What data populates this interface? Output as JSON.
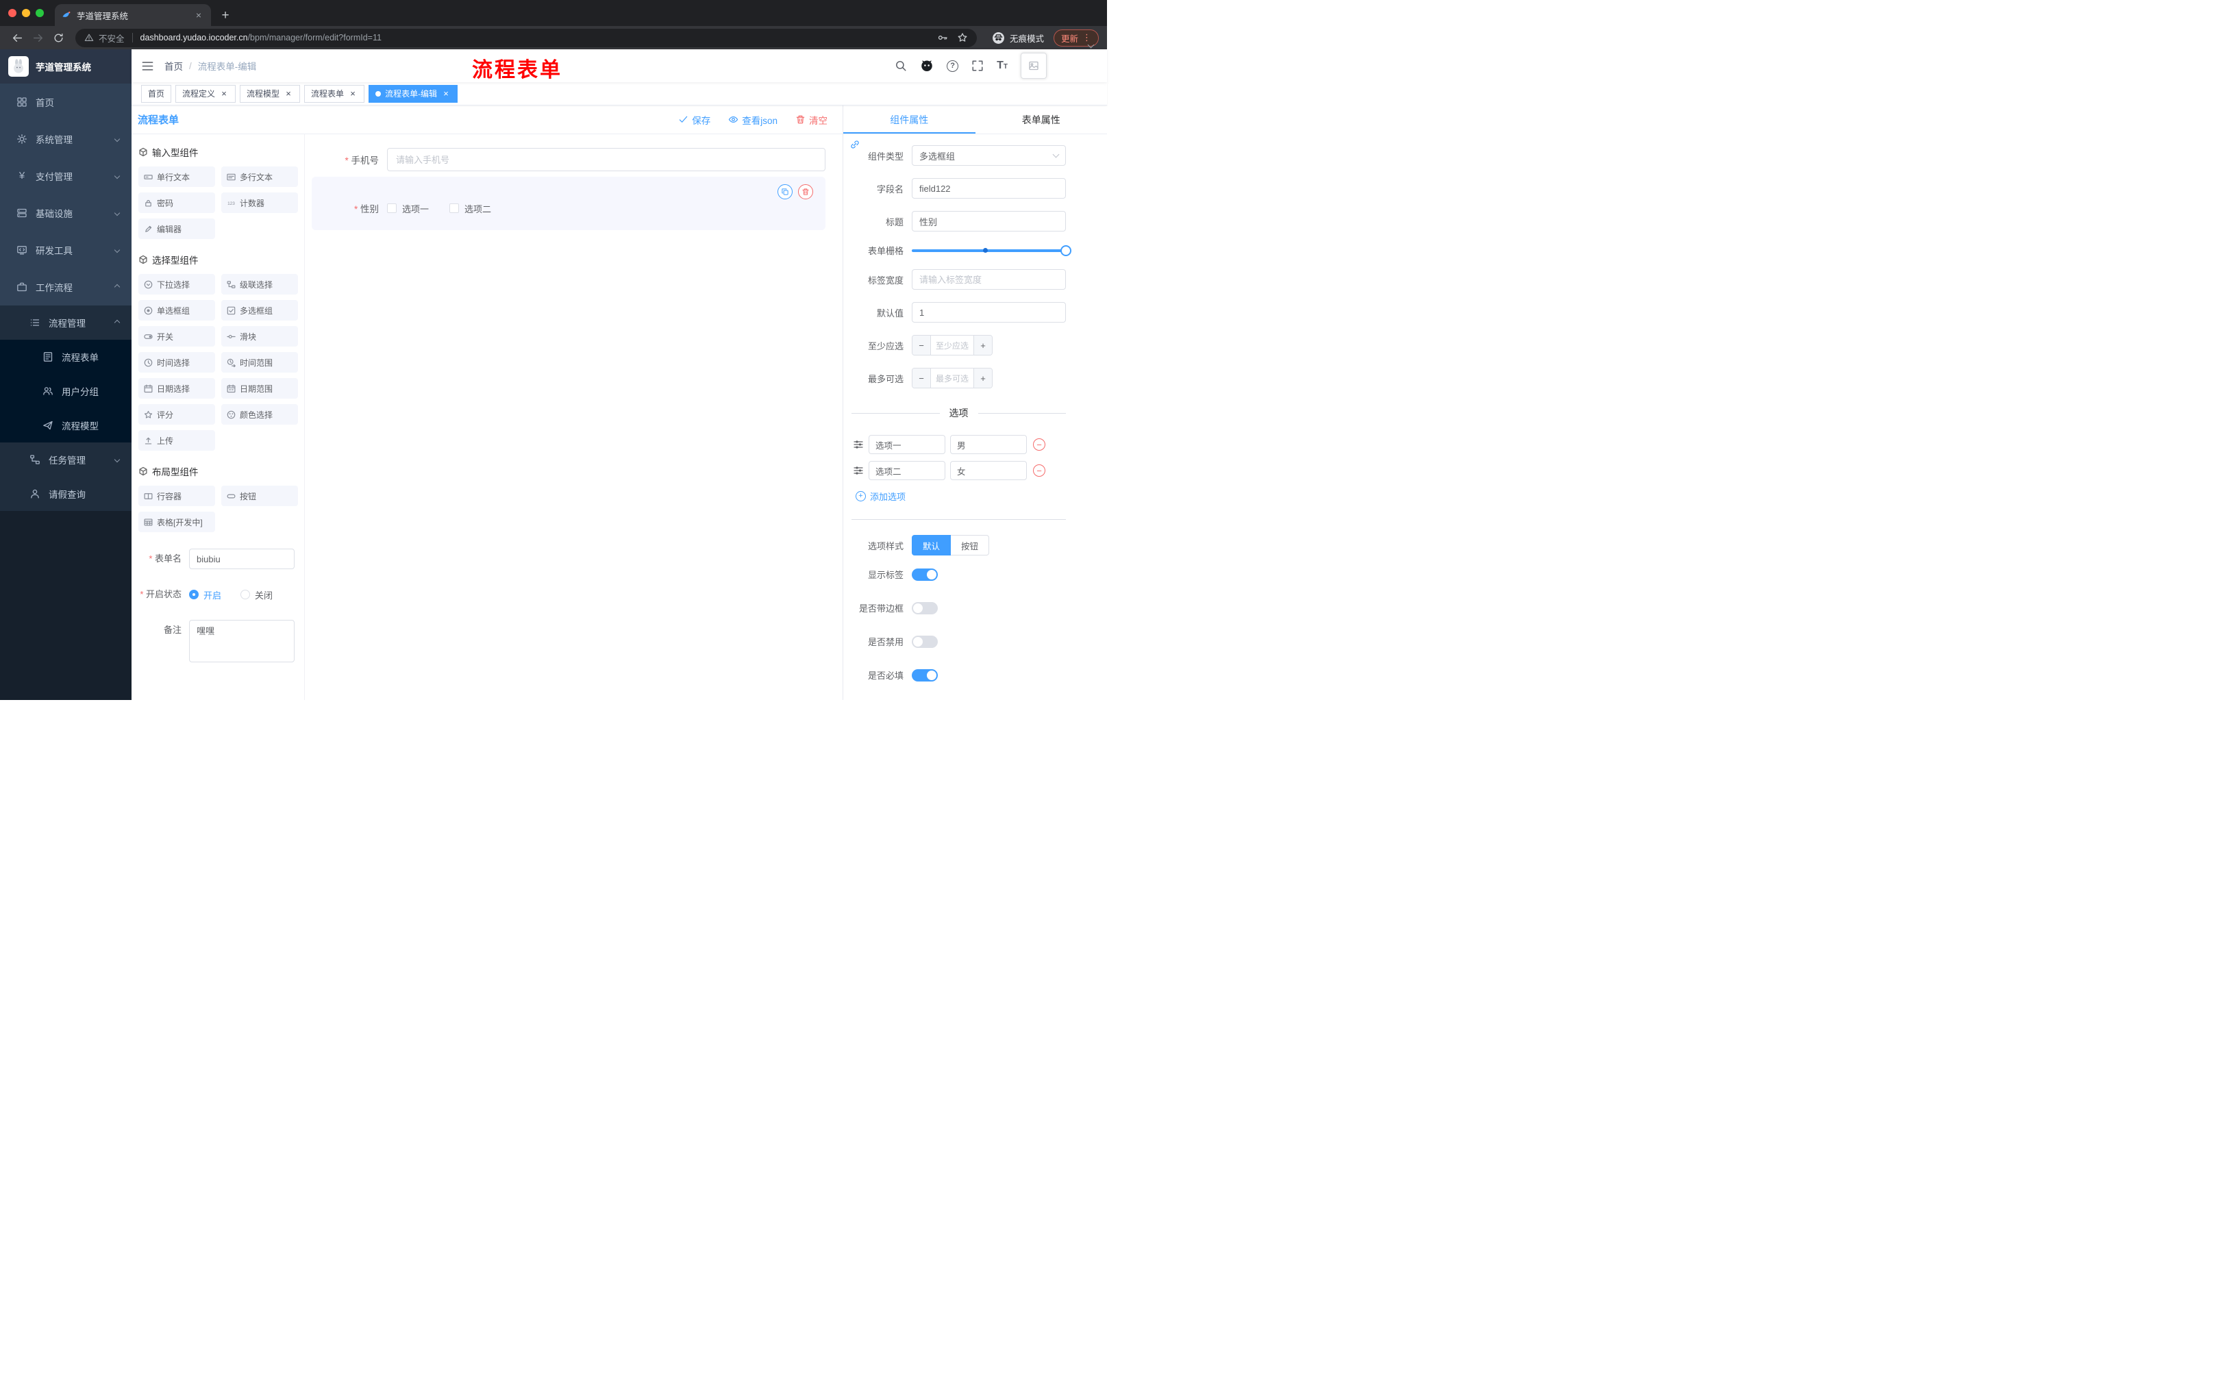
{
  "browser": {
    "tab_title": "芋道管理系统",
    "security_label": "不安全",
    "url_domain": "dashboard.yudao.iocoder.cn",
    "url_path": "/bpm/manager/form/edit?formId=11",
    "incognito_label": "无痕模式",
    "update_label": "更新"
  },
  "sidebar": {
    "logo_title": "芋道管理系统",
    "items": [
      {
        "label": "首页",
        "icon": "dashboard-icon",
        "expandable": false
      },
      {
        "label": "系统管理",
        "icon": "gear-icon",
        "expandable": true
      },
      {
        "label": "支付管理",
        "icon": "yen-icon",
        "expandable": true
      },
      {
        "label": "基础设施",
        "icon": "server-icon",
        "expandable": true
      },
      {
        "label": "研发工具",
        "icon": "dev-tools-icon",
        "expandable": true
      },
      {
        "label": "工作流程",
        "icon": "briefcase-icon",
        "expandable": true,
        "expanded": true
      }
    ],
    "workflow_submenu": [
      {
        "label": "流程管理",
        "icon": "list-icon",
        "expanded": true
      },
      {
        "label": "任务管理",
        "icon": "tree-icon",
        "expandable": true
      },
      {
        "label": "请假查询",
        "icon": "user-icon"
      }
    ],
    "process_children": [
      {
        "label": "流程表单",
        "icon": "form-icon"
      },
      {
        "label": "用户分组",
        "icon": "users-icon"
      },
      {
        "label": "流程模型",
        "icon": "send-icon"
      }
    ]
  },
  "navbar": {
    "breadcrumb": {
      "home": "首页",
      "separator": "/",
      "current": "流程表单-编辑"
    },
    "annotation": "流程表单"
  },
  "tags_view": {
    "tags": [
      {
        "label": "首页",
        "closable": false,
        "active": false
      },
      {
        "label": "流程定义",
        "closable": true,
        "active": false
      },
      {
        "label": "流程模型",
        "closable": true,
        "active": false
      },
      {
        "label": "流程表单",
        "closable": true,
        "active": false
      },
      {
        "label": "流程表单-编辑",
        "closable": true,
        "active": true
      }
    ]
  },
  "designer": {
    "title": "流程表单",
    "actions": {
      "save": "保存",
      "view_json": "查看json",
      "clear": "清空"
    },
    "palette": {
      "sections": [
        {
          "title": "输入型组件",
          "items": [
            {
              "label": "单行文本",
              "icon": "input-icon"
            },
            {
              "label": "多行文本",
              "icon": "textarea-icon"
            },
            {
              "label": "密码",
              "icon": "password-icon"
            },
            {
              "label": "计数器",
              "icon": "counter-icon"
            },
            {
              "label": "编辑器",
              "icon": "editor-icon"
            }
          ]
        },
        {
          "title": "选择型组件",
          "items": [
            {
              "label": "下拉选择",
              "icon": "select-icon"
            },
            {
              "label": "级联选择",
              "icon": "cascader-icon"
            },
            {
              "label": "单选框组",
              "icon": "radio-icon"
            },
            {
              "label": "多选框组",
              "icon": "checkbox-icon"
            },
            {
              "label": "开关",
              "icon": "switch-icon"
            },
            {
              "label": "滑块",
              "icon": "slider-icon"
            },
            {
              "label": "时间选择",
              "icon": "time-icon"
            },
            {
              "label": "时间范围",
              "icon": "time-range-icon"
            },
            {
              "label": "日期选择",
              "icon": "date-icon"
            },
            {
              "label": "日期范围",
              "icon": "date-range-icon"
            },
            {
              "label": "评分",
              "icon": "rate-icon"
            },
            {
              "label": "颜色选择",
              "icon": "color-icon"
            },
            {
              "label": "上传",
              "icon": "upload-icon"
            }
          ]
        },
        {
          "title": "布局型组件",
          "items": [
            {
              "label": "行容器",
              "icon": "row-icon"
            },
            {
              "label": "按钮",
              "icon": "button-icon"
            },
            {
              "label": "表格[开发中]",
              "icon": "table-icon"
            }
          ]
        }
      ]
    },
    "meta_form": {
      "form_name": {
        "label": "表单名",
        "value": "biubiu",
        "required": true
      },
      "status": {
        "label": "开启状态",
        "required": true,
        "options": [
          "开启",
          "关闭"
        ],
        "selected": "开启"
      },
      "remark": {
        "label": "备注",
        "value": "嘿嘿"
      }
    },
    "canvas": {
      "phone_field": {
        "label": "手机号",
        "placeholder": "请输入手机号",
        "required": true
      },
      "gender_field": {
        "label": "性别",
        "required": true,
        "options": [
          "选项一",
          "选项二"
        ],
        "selected": true
      }
    }
  },
  "properties_panel": {
    "tabs": [
      {
        "label": "组件属性",
        "active": true
      },
      {
        "label": "表单属性",
        "active": false
      }
    ],
    "rows": {
      "component_type": {
        "label": "组件类型",
        "value": "多选框组"
      },
      "field_name": {
        "label": "字段名",
        "value": "field122"
      },
      "title": {
        "label": "标题",
        "value": "性别"
      },
      "grid": {
        "label": "表单栅格"
      },
      "label_width": {
        "label": "标签宽度",
        "placeholder": "请输入标签宽度"
      },
      "default_value": {
        "label": "默认值",
        "value": "1"
      },
      "min_select": {
        "label": "至少应选",
        "placeholder": "至少应选"
      },
      "max_select": {
        "label": "最多可选",
        "placeholder": "最多可选"
      }
    },
    "options": {
      "divider_label": "选项",
      "rows": [
        {
          "label": "选项一",
          "value": "男"
        },
        {
          "label": "选项二",
          "value": "女"
        }
      ],
      "add_label": "添加选项"
    },
    "style": {
      "option_style": {
        "label": "选项样式",
        "options": [
          "默认",
          "按钮"
        ],
        "selected": "默认"
      },
      "show_label": {
        "label": "显示标签",
        "on": true
      },
      "border": {
        "label": "是否带边框",
        "on": false
      },
      "disabled": {
        "label": "是否禁用",
        "on": false
      },
      "required": {
        "label": "是否必填",
        "on": true
      }
    }
  },
  "colors": {
    "accent": "#409EFF",
    "danger": "#F56C6C",
    "annotation": "#FF0000",
    "sidebar_bg": "#304156",
    "submenu_bg": "#1F2D3D",
    "active_tag": "#409EFF"
  }
}
